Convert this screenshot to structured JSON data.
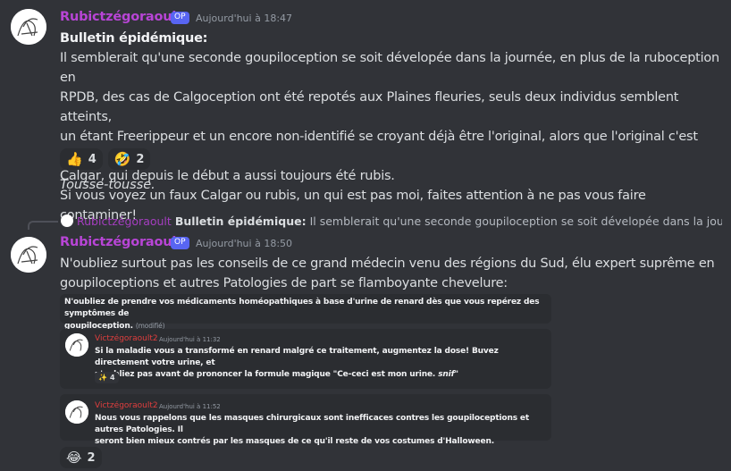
{
  "message1": {
    "username": "Rubictzégoraoult",
    "badge": "OP",
    "timestamp": "Aujourd'hui à 18:47",
    "heading": "Bulletin épidémique:",
    "lines": [
      "Il semblerait qu'une seconde goupiloception se soit dévelopée dans la journée, en plus de la ruboception en",
      "RPDB, des cas de Calgoception ont été repotés aux Plaines fleuries, seuls deux individus semblent atteints,",
      "un étant Freerippeur et un encore non-identifié se croyant déjà être l'original, alors que l'original c'est moi,",
      "Calgar, qui depuis le début a aussi toujours été rubis.",
      "Si vous voyez un faux Calgar ou rubis, un qui est pas moi, faites attention à ne pas vous faire contaminer!"
    ],
    "reactions": [
      {
        "emoji": "👍",
        "count": "4"
      },
      {
        "emoji": "🤣",
        "count": "2"
      }
    ],
    "followup": "Tousse-tousse."
  },
  "reply": {
    "username": "Rubictzégoraoult",
    "bold": "Bulletin épidémique:",
    "text": "Il semblerait qu'une seconde goupiloception se soit dévelopée dans la journée, en"
  },
  "message2": {
    "username": "Rubictzégoraoult",
    "badge": "OP",
    "timestamp": "Aujourd'hui à 18:50",
    "lines": [
      "N'oubliez surtout pas les conseils de ce grand médecin venu des régions du Sud, élu expert suprême en",
      "goupiloceptions et autres Patologies de part se flamboyante chevelure:"
    ],
    "embed": {
      "top": {
        "line1": "N'oubliez de prendre vos médicaments homéopathiques à base d'urine de renard dès que vous repérez des symptômes de",
        "line2": "goupiloception.",
        "edited": "(modifié)"
      },
      "msg_a": {
        "name": "Victzégoraoult2",
        "timestamp": "Aujourd'hui à 11:32",
        "line1": "Si la maladie vous a transformé en renard malgré ce traitement, augmentez la dose! Buvez directement votre urine, et",
        "line2": "n'oubliez pas avant de prononcer la formule magique \"Ce-ceci est mon urine.",
        "line2_italic": "snif",
        "line2_end": "\"",
        "reaction_emoji": "✨",
        "reaction_count": "4"
      },
      "msg_b": {
        "name": "Victzégoraoult2",
        "timestamp": "Aujourd'hui à 11:52",
        "line1": "Nous vous rappelons que les masques chirurgicaux sont inefficaces contres les goupiloceptions et autres Patologies. Il",
        "line2": "seront bien mieux contrés par les masques de ce qu'il reste de vos costumes d'Halloween."
      }
    },
    "reactions": [
      {
        "emoji": "😂",
        "count": "2"
      }
    ]
  }
}
